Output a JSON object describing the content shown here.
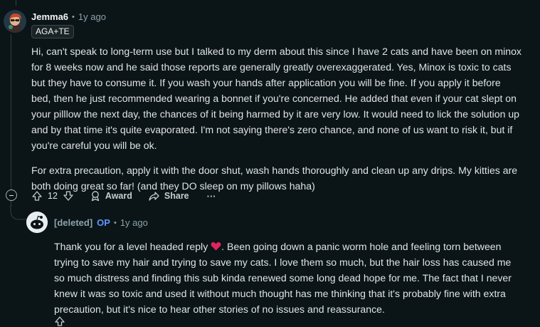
{
  "comment": {
    "author": "Jemma6",
    "time": "1y ago",
    "flair": "AGA+TE",
    "paragraphs": [
      "Hi, can't speak to long-term use but I talked to my derm about this since I have 2 cats and have been on minox for 8 weeks now and he said those reports are generally greatly overexaggerated. Yes, Minox is toxic to cats but they have to consume it. If you wash your hands after application you will be fine. If you apply it before bed, then he just recommended wearing a bonnet if you're concerned. He added that even if your cat slept on your pilllow the next day, the chances of it being harmed by it are very low. It would need to lick the solution up and by that time it's quite evaporated. I'm not saying there's zero chance, and none of us want to risk it, but if you're careful you will be ok.",
      "For extra precaution, apply it with the door shut, wash hands thoroughly and clean up any drips. My kitties are both doing great so far! (and they DO sleep on my pillows haha)"
    ],
    "actions": {
      "votes": "12",
      "award": "Award",
      "share": "Share",
      "more": "···"
    }
  },
  "reply": {
    "author": "[deleted]",
    "op_badge": "OP",
    "time": "1y ago",
    "text_before_heart": "Thank you for a level headed reply ",
    "text_after_heart": ". Been going down a panic worm hole and feeling torn between trying to save my hair and trying to save my cats. I love them so much, but the hair loss has caused me so much distress and finding this sub kinda renewed some long dead hope for me. The fact that I never knew it was so toxic and used it without much thought has me thinking that it's probably fine with extra precaution, but it's nice to hear other stories of no issues and reassurance."
  },
  "colors": {
    "background": "#0b1416",
    "op": "#6196ff",
    "heart": "#e0245e",
    "muted": "#8ba2ad"
  }
}
